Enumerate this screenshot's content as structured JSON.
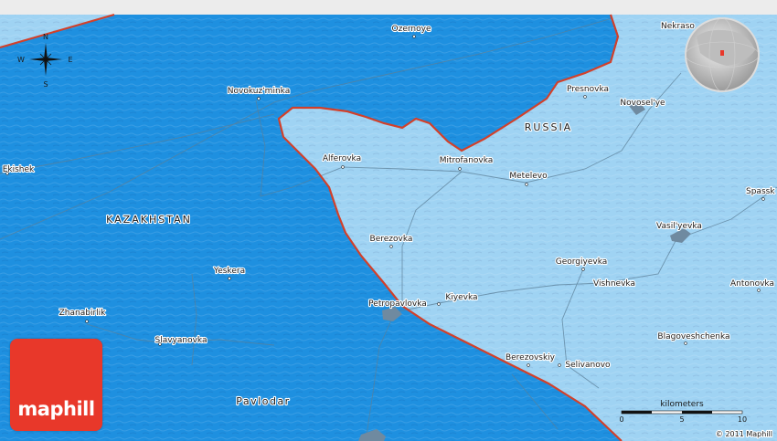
{
  "colors": {
    "kazakhstan_fill": "#1e90e0",
    "russia_fill": "#9fd3f3",
    "border": "#d2402a",
    "roads": "#5b7f98",
    "logo_bg": "#e8382a"
  },
  "compass": {
    "n": "N",
    "e": "E",
    "s": "S",
    "w": "W"
  },
  "countries": {
    "kazakhstan": "KAZAKHSTAN",
    "russia": "RUSSIA"
  },
  "regions": {
    "pavlodar": "Pavlodar"
  },
  "places": {
    "ozernoye": "Ozernoye",
    "nekrasovka": "Nekraso",
    "novokuzminka": "Novokuz'minka",
    "presnovka": "Presnovka",
    "novoselye": "Novosel'ye",
    "ekishek": "Ekishek",
    "alferovka": "Alferovka",
    "mitrofanovka": "Mitrofanovka",
    "metelevo": "Metelevo",
    "spassk": "Spassk",
    "berezovka": "Berezovka",
    "vasilyevka": "Vasil'yevka",
    "yeskera": "Yeskera",
    "georgiyevka": "Georgiyevka",
    "vishnevka": "Vishnevka",
    "antonovka": "Antonovka",
    "petropavlovka": "Petropavlovka",
    "kiyevka": "Kiyevka",
    "zhanabirlik": "Zhanabirlik",
    "slavyanovka": "Slavyanovka",
    "blagoveshchenka": "Blagoveshchenka",
    "berezovskiy": "Berezovskiy",
    "selivanovo": "Selivanovo"
  },
  "scale": {
    "title": "kilometers",
    "ticks": [
      "0",
      "5",
      "10"
    ]
  },
  "copyright": "© 2011 Maphill",
  "logo": {
    "text": "maphill"
  },
  "icons": {
    "compass": "compass-rose-icon",
    "globe": "globe-locator-icon",
    "town": "town-marker-icon"
  }
}
